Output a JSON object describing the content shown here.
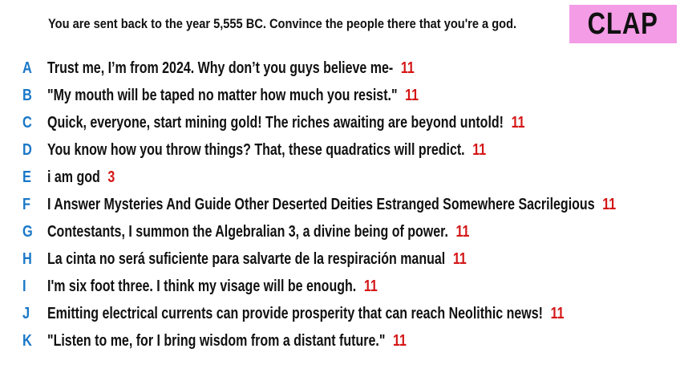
{
  "prompt": "You are sent back to the year 5,555 BC. Convince the people there that you're a god.",
  "badge": "CLAP",
  "colors": {
    "badge_bg": "#f49ce6",
    "letter": "#1a78c8",
    "score": "#d41616",
    "text": "#111111"
  },
  "answers": [
    {
      "letter": "A",
      "text": "Trust me, I’m from 2024. Why don’t you guys believe me-",
      "score": "11"
    },
    {
      "letter": "B",
      "text": "\"My mouth will be taped no matter how much you resist.\"",
      "score": "11"
    },
    {
      "letter": "C",
      "text": "Quick, everyone, start mining gold! The riches awaiting are beyond untold!",
      "score": "11"
    },
    {
      "letter": "D",
      "text": "You know how you throw things? That, these quadratics will predict.",
      "score": "11"
    },
    {
      "letter": "E",
      "text": "i am god",
      "score": "3"
    },
    {
      "letter": "F",
      "text": "I Answer Mysteries And Guide Other Deserted Deities Estranged Somewhere Sacrilegious",
      "score": "11"
    },
    {
      "letter": "G",
      "text": "Contestants, I summon the Algebralian 3, a divine being of power.",
      "score": "11"
    },
    {
      "letter": "H",
      "text": "La cinta no será suficiente para salvarte de la respiración manual",
      "score": "11"
    },
    {
      "letter": "I",
      "text": "I'm six foot three. I think my visage will be enough.",
      "score": "11"
    },
    {
      "letter": "J",
      "text": "Emitting electrical currents can provide prosperity that can reach Neolithic news!",
      "score": "11"
    },
    {
      "letter": "K",
      "text": "\"Listen to me, for I bring wisdom from a distant future.\"",
      "score": "11"
    }
  ]
}
